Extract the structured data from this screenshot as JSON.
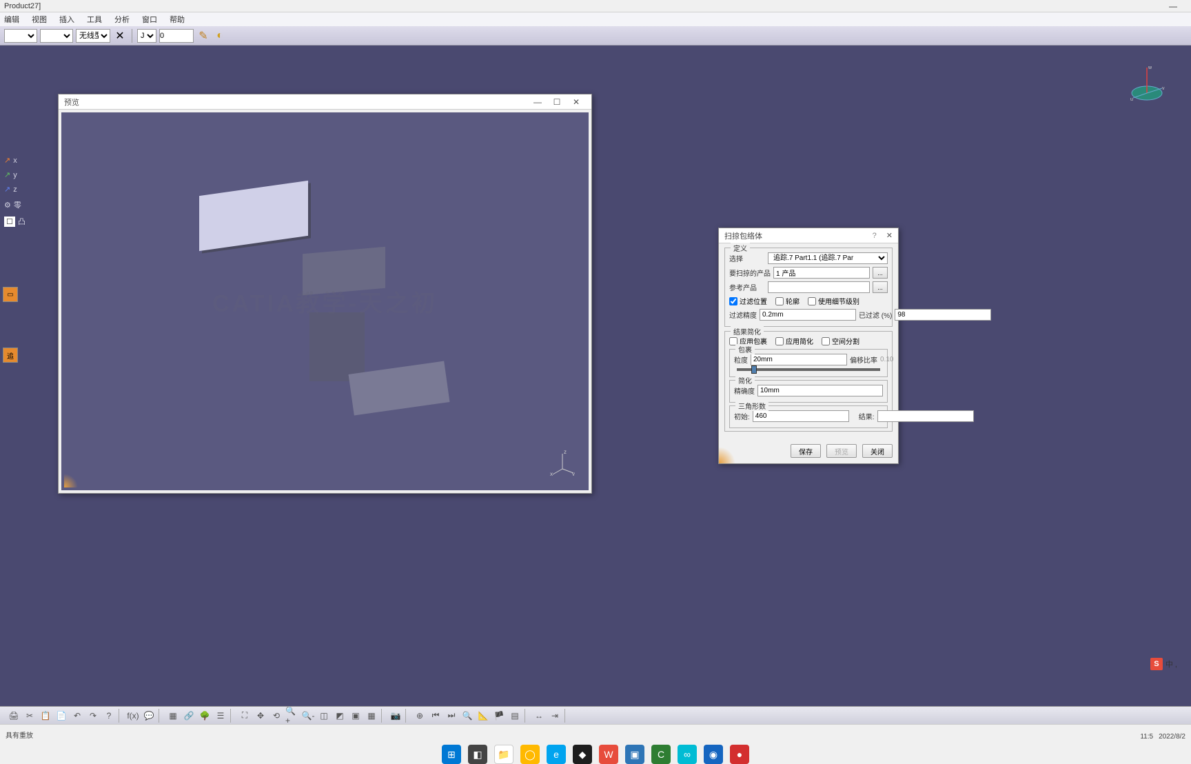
{
  "title": "Product27]",
  "menu": {
    "items": [
      "编辑",
      "视图",
      "插入",
      "工具",
      "分析",
      "窗口",
      "帮助"
    ]
  },
  "toolbar": {
    "lineType": "无线型",
    "curve": "J",
    "value": "0"
  },
  "tree": {
    "items": [
      "x",
      "y",
      "z",
      "零"
    ]
  },
  "preview": {
    "title": "预览",
    "axes": [
      "x",
      "y",
      "z"
    ]
  },
  "watermark": "CATIA教学-天之初",
  "compass": {
    "labels": [
      "w",
      "v",
      "u"
    ]
  },
  "dialog": {
    "title": "扫掠包络体",
    "help": "?",
    "defGroup": "定义",
    "selectLabel": "选择",
    "selectValue": "追踪.7 Part1.1 (追踪.7 Par",
    "scanProdLabel": "要扫掠的产品",
    "scanProdValue": "1 产品",
    "refProdLabel": "参考产品",
    "browseBtn": "...",
    "filterPosLabel": "过滤位置",
    "contourLabel": "轮廓",
    "useDetailLabel": "使用细节级别",
    "filterPrecLabel": "过滤精度",
    "filterPrecValue": "0.2mm",
    "filteredPctLabel": "已过滤 (%)",
    "filteredPctValue": "98",
    "simplifyGroup": "结果简化",
    "applyWrapLabel": "应用包裹",
    "applySimpLabel": "应用简化",
    "spaceSplitLabel": "空间分割",
    "wrapGroup": "包裹",
    "grainLabel": "粒度",
    "grainValue": "20mm",
    "offsetRatioLabel": "偏移比率",
    "offsetRatioValue": "0.10",
    "simpGroup": "简化",
    "precisionLabel": "精确度",
    "precisionValue": "10mm",
    "triGroup": "三角形数",
    "initialLabel": "初始:",
    "initialValue": "460",
    "resultLabel": "结果:",
    "resultValue": "",
    "saveBtn": "保存",
    "previewBtn": "预览",
    "closeBtn": "关闭"
  },
  "statusbar": {
    "msg": "具有重放",
    "time": "11:5",
    "date": "2022/8/2"
  },
  "ime": {
    "s": "S",
    "txt": "中 ,"
  }
}
